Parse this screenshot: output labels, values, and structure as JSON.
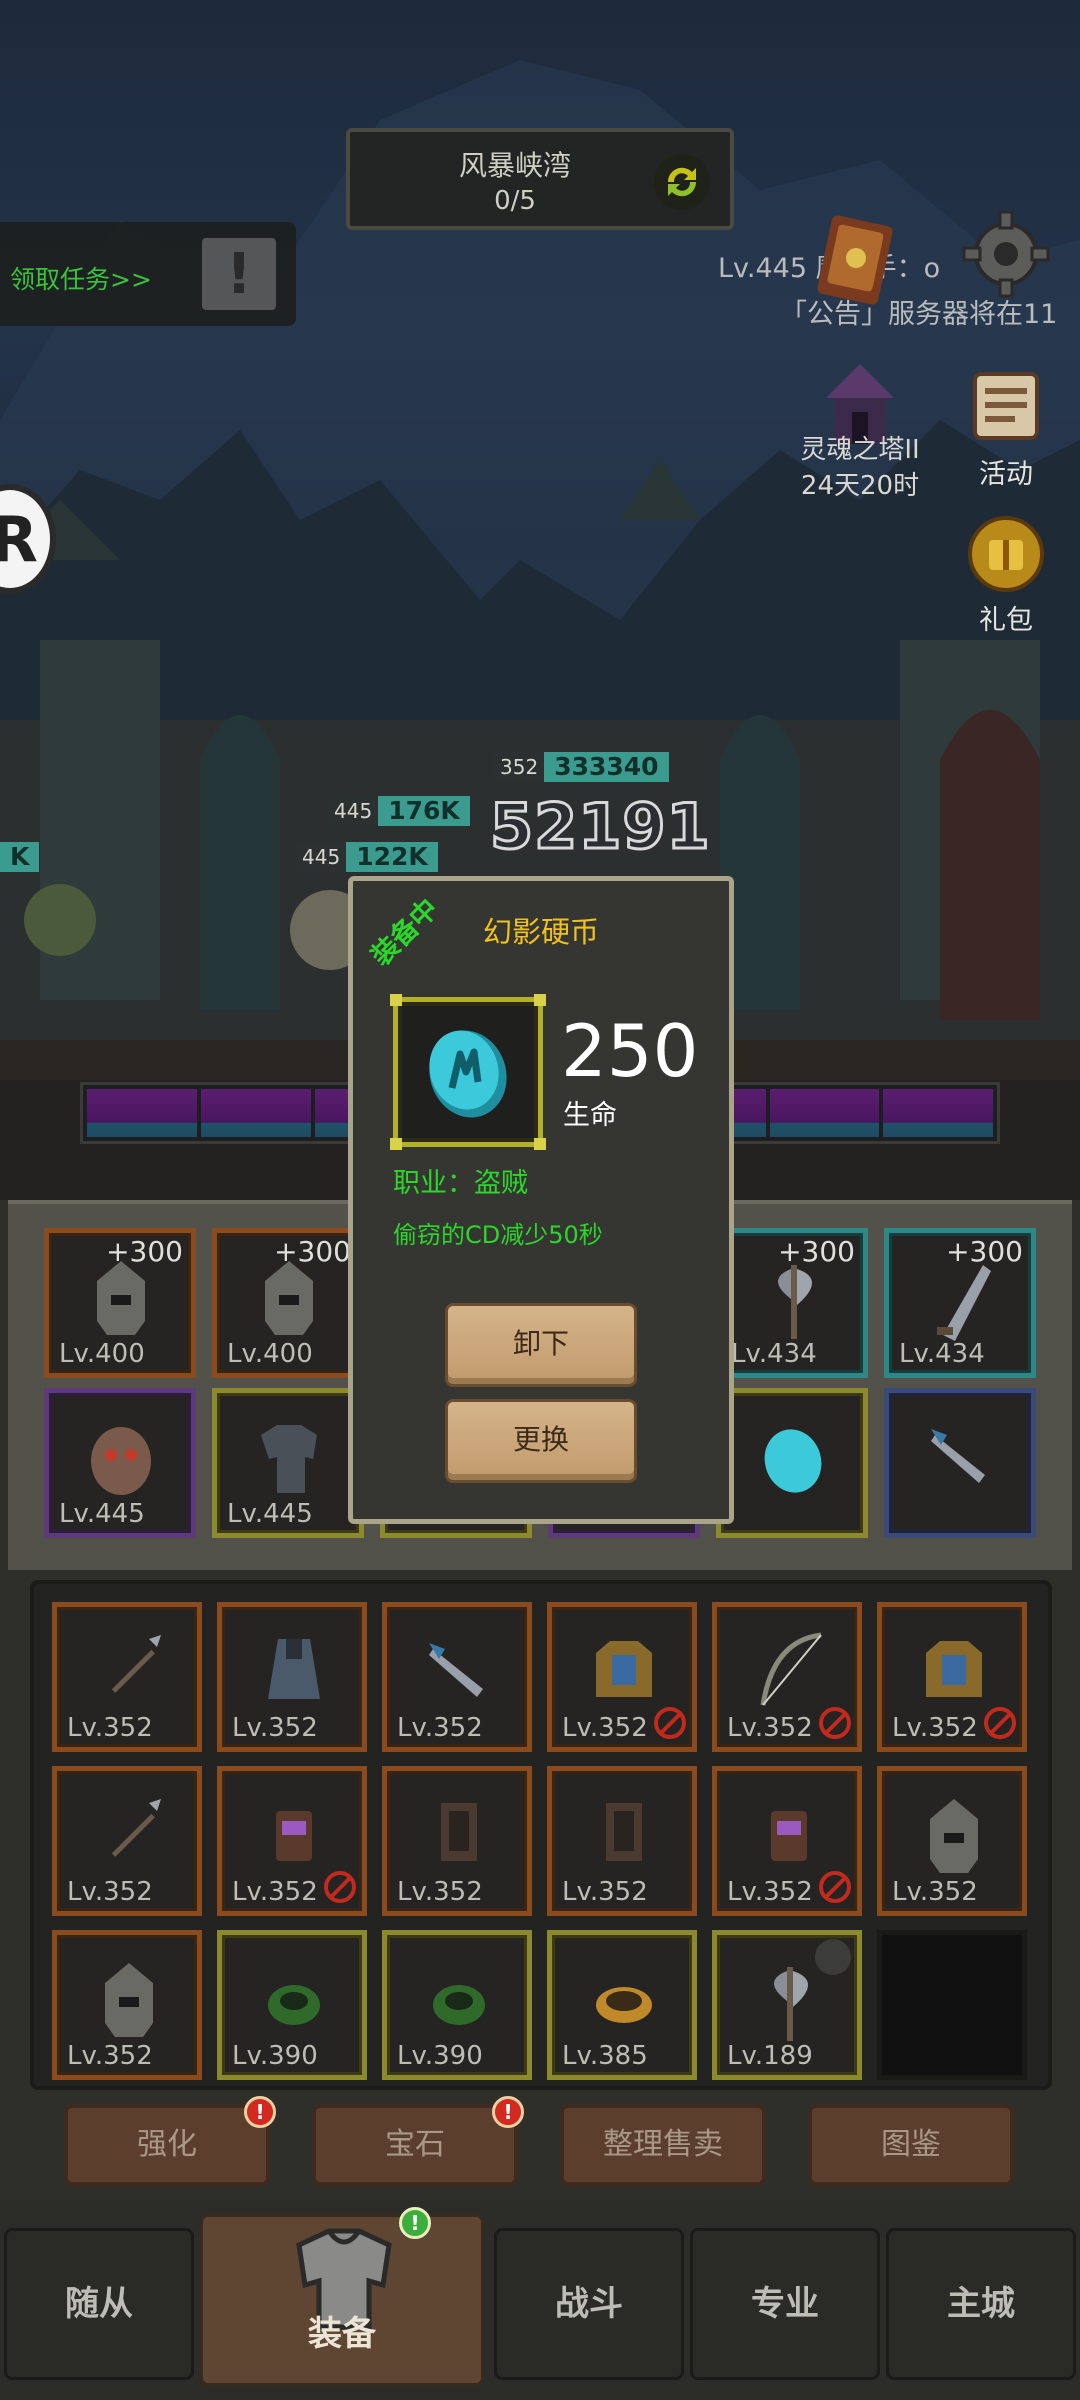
{
  "top": {
    "map_name": "风暴峡湾",
    "map_progress": "0/5",
    "quest_label": "领取任务>>",
    "notice_line_1": "Lv.445 魔猎手：o",
    "notice_line_2": "「公告」服务器将在11",
    "tower_label": "灵魂之塔II",
    "tower_timer": "24天20时",
    "activity_label": "活动",
    "gift_label": "礼包",
    "r_badge": "R"
  },
  "battle": {
    "enemy_level": "352",
    "enemy_hp": "333340",
    "damage": "52191",
    "ally1_level": "445",
    "ally1_hp": "176K",
    "ally2_level": "445",
    "ally2_hp": "122K",
    "edge_hp": "K"
  },
  "equipped": {
    "row1": [
      {
        "plus": "+300",
        "level": "Lv.400",
        "rarity": "orange",
        "icon": "helmet-icon"
      },
      {
        "plus": "+300",
        "level": "Lv.400",
        "rarity": "orange",
        "icon": "helmet-icon"
      },
      {
        "plus": "+300",
        "level": "Lv.434",
        "rarity": "cyan",
        "icon": "axe-icon"
      },
      {
        "plus": "+300",
        "level": "Lv.434",
        "rarity": "cyan",
        "icon": "blade-icon"
      }
    ],
    "row2": [
      {
        "level": "Lv.445",
        "rarity": "purple",
        "icon": "mask-icon"
      },
      {
        "level": "Lv.445",
        "rarity": "yellow",
        "icon": "armor-icon"
      },
      {
        "level": "",
        "rarity": "yellow",
        "icon": "coin-icon"
      },
      {
        "level": "",
        "rarity": "navy",
        "icon": "dagger-icon"
      }
    ]
  },
  "inventory": [
    {
      "level": "Lv.352",
      "rarity": "orange",
      "icon": "spear-icon",
      "banned": false,
      "locked": false
    },
    {
      "level": "Lv.352",
      "rarity": "orange",
      "icon": "cloak-icon",
      "banned": false,
      "locked": false
    },
    {
      "level": "Lv.352",
      "rarity": "orange",
      "icon": "dagger-icon",
      "banned": false,
      "locked": false
    },
    {
      "level": "Lv.352",
      "rarity": "orange",
      "icon": "chest-armor-icon",
      "banned": true,
      "locked": false
    },
    {
      "level": "Lv.352",
      "rarity": "orange",
      "icon": "bow-icon",
      "banned": true,
      "locked": false
    },
    {
      "level": "Lv.352",
      "rarity": "orange",
      "icon": "chest-armor-icon",
      "banned": true,
      "locked": false
    },
    {
      "level": "Lv.352",
      "rarity": "orange",
      "icon": "spear-icon",
      "banned": false,
      "locked": false
    },
    {
      "level": "Lv.352",
      "rarity": "orange",
      "icon": "bracer-icon",
      "banned": true,
      "locked": false
    },
    {
      "level": "Lv.352",
      "rarity": "orange",
      "icon": "greaves-icon",
      "banned": false,
      "locked": false
    },
    {
      "level": "Lv.352",
      "rarity": "orange",
      "icon": "greaves-icon",
      "banned": false,
      "locked": false
    },
    {
      "level": "Lv.352",
      "rarity": "orange",
      "icon": "bracer-icon",
      "banned": true,
      "locked": false
    },
    {
      "level": "Lv.352",
      "rarity": "orange",
      "icon": "helmet-icon",
      "banned": false,
      "locked": false
    },
    {
      "level": "Lv.352",
      "rarity": "orange",
      "icon": "helmet-icon",
      "banned": false,
      "locked": false
    },
    {
      "level": "Lv.390",
      "rarity": "yellow",
      "icon": "ring-icon",
      "banned": false,
      "locked": false
    },
    {
      "level": "Lv.390",
      "rarity": "yellow",
      "icon": "ring-icon",
      "banned": false,
      "locked": false
    },
    {
      "level": "Lv.385",
      "rarity": "yellow",
      "icon": "bangle-icon",
      "banned": false,
      "locked": false
    },
    {
      "level": "Lv.189",
      "rarity": "yellow",
      "icon": "axe-icon",
      "banned": false,
      "locked": true
    },
    {
      "level": "",
      "rarity": "empty",
      "icon": "",
      "banned": false,
      "locked": false
    }
  ],
  "actions": {
    "enhance": "强化",
    "gem": "宝石",
    "sort_sell": "整理售卖",
    "codex": "图鉴",
    "badge": "!"
  },
  "nav": {
    "followers": "随从",
    "equipment": "装备",
    "battle": "战斗",
    "profession": "专业",
    "main_city": "主城",
    "badge": "!"
  },
  "popup": {
    "status_tag": "装备中",
    "item_name": "幻影硬币",
    "stat_value": "250",
    "stat_label": "生命",
    "job_line": "职业：盗贼",
    "effect_line": "偷窃的CD减少50秒",
    "unequip": "卸下",
    "swap": "更换"
  },
  "colors": {
    "title_gold": "#f1c21e",
    "effect_green": "#2bd72b",
    "frame_gold": "#b5b02a",
    "coin_cyan": "#3cc9d9"
  }
}
